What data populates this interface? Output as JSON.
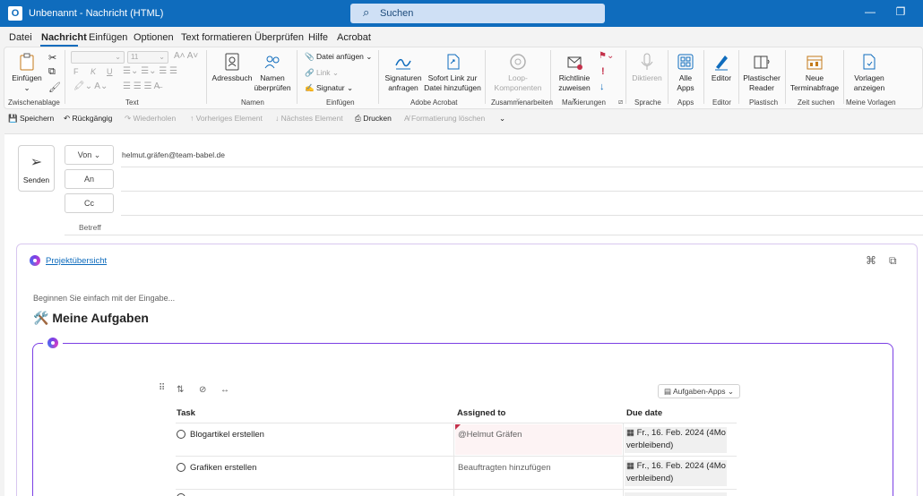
{
  "titlebar": {
    "title": "Unbenannt - Nachricht (HTML)",
    "search_placeholder": "Suchen",
    "icons": [
      "outlook-icon",
      "search-icon",
      "minimize-icon",
      "restore-icon"
    ]
  },
  "menu": {
    "tabs": [
      "Datei",
      "Nachricht",
      "Einfügen",
      "Optionen",
      "Text formatieren",
      "Überprüfen",
      "Hilfe",
      "Acrobat"
    ],
    "active": "Nachricht"
  },
  "ribbon": {
    "groups": [
      "Zwischenablage",
      "Text",
      "Namen",
      "Einfügen",
      "Adobe Acrobat",
      "Zusammenarbeiten",
      "Markierungen",
      "Sprache",
      "Apps",
      "Editor",
      "Plastisch",
      "Zeit suchen",
      "Meine Vorlagen"
    ],
    "buttons": {
      "einfuegen": "Einfügen",
      "font_size": "11",
      "bold": "F",
      "italic": "K",
      "underline": "U",
      "adressbuch": "Adressbuch",
      "namen_1": "Namen",
      "namen_2": "überprüfen",
      "datei_anfuegen": "Datei anfügen",
      "link": "Link",
      "signatur": "Signatur",
      "signaturen_1": "Signaturen",
      "signaturen_2": "anfragen",
      "sofort_link_1": "Sofort Link zur",
      "sofort_link_2": "Datei hinzufügen",
      "loop_1": "Loop-",
      "loop_2": "Komponenten",
      "richtlinie_1": "Richtlinie",
      "richtlinie_2": "zuweisen",
      "diktieren": "Diktieren",
      "alle_apps_1": "Alle",
      "alle_apps_2": "Apps",
      "editor": "Editor",
      "reader_1": "Plastischer",
      "reader_2": "Reader",
      "termin_1": "Neue",
      "termin_2": "Terminabfrage",
      "vorlagen_1": "Vorlagen",
      "vorlagen_2": "anzeigen"
    }
  },
  "quick_access": {
    "speichern": "Speichern",
    "rueckgaengig": "Rückgängig",
    "wiederholen": "Wiederholen",
    "vorheriges": "Vorheriges Element",
    "naechstes": "Nächstes Element",
    "drucken": "Drucken",
    "formatierung": "Formatierung löschen"
  },
  "compose": {
    "send_label": "Senden",
    "from_label": "Von",
    "from_value": "helmut.gräfen@team-babel.de",
    "to_label": "An",
    "cc_label": "Cc",
    "subject_label": "Betreff"
  },
  "loop": {
    "link_text": "Projektübersicht",
    "hint": "Beginnen Sie einfach mit der Eingabe...",
    "heading": "🛠️ Meine Aufgaben",
    "apps_button": "Aufgaben-Apps",
    "columns": [
      "Task",
      "Assigned to",
      "Due date"
    ],
    "rows": [
      {
        "task": "Blogartikel erstellen",
        "assigned": "@Helmut Gräfen",
        "due_1": "Fr., 16. Feb. 2024 (4Mo",
        "due_2": "verbleibend)"
      },
      {
        "task": "Grafiken erstellen",
        "assigned": "Beauftragten hinzufügen",
        "due_1": "Fr., 16. Feb. 2024 (4Mo",
        "due_2": "verbleibend)"
      }
    ]
  },
  "colors": {
    "brand": "#0f6cbd",
    "loop_accent": "#7b3fe4",
    "flag": "#c4314b"
  }
}
